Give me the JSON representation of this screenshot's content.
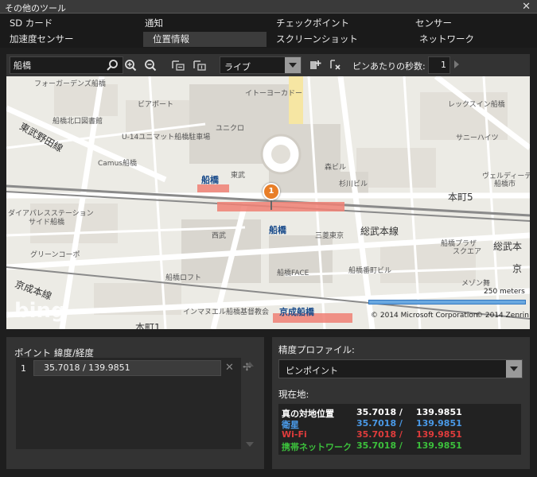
{
  "window": {
    "title": "その他のツール",
    "close_label": "✕"
  },
  "tabs": {
    "row1": [
      "SD カード",
      "通知",
      "チェックポイント",
      "センサー"
    ],
    "row2": [
      "加速度センサー",
      "位置情報",
      "スクリーンショット",
      "ネットワーク"
    ],
    "active": "位置情報"
  },
  "toolbar": {
    "search_value": "船橋",
    "mode_value": "ライブ",
    "seconds_label": "ピンあたりの秒数:",
    "seconds_value": "1"
  },
  "map": {
    "pin_label": "1",
    "labels": {
      "forager": "フォーガーデンズ船橋",
      "ito": "イトーヨーカドー",
      "rexin": "レックスイン船橋",
      "biaport": "ビアポート",
      "funabashi_kita": "船橋北口図書館",
      "u14": "U-14ユニマット船橋駐車場",
      "uniqlo": "ユニクロ",
      "sunny": "サニーハイツ",
      "higashi": "東武野田線",
      "camus": "Camus船橋",
      "mori": "森ビル",
      "sugino": "杉川ビル",
      "welldie": "ヴェルディーデ",
      "funabashi_nearby": "船橋市",
      "tobu": "東武",
      "honcho5": "本町5",
      "funabashi_station": "船橋",
      "diapalace": "ダイアパレスステーション",
      "side": "サイド船橋",
      "seibu": "西武",
      "sobu": "総武本線",
      "misu": "三菱東京",
      "green": "グリーンコーポ",
      "plaza": "船橋プラザ",
      "square": "スクエア",
      "sobu2": "総武本",
      "keisei_line": "京成本線",
      "loft": "船橋ロフト",
      "face": "船橋FACE",
      "funabashi_teramachi": "船橋番町ビル",
      "meison": "メゾン舞",
      "kyo": "京",
      "keisei_station": "京成船橋",
      "inmanel": "インマヌエル船橋基督教会",
      "honcho1": "本町1"
    },
    "scale_label": "250 meters",
    "bing": "bing",
    "copyright_ms": "© 2014 Microsoft Corporation",
    "copyright_zenrin": "© 2014 Zenrin"
  },
  "points_panel": {
    "col_point": "ポイント",
    "col_latlng": "緯度/経度",
    "rows": [
      {
        "index": "1",
        "coord": "35.7018 /  139.9851"
      }
    ]
  },
  "profile_panel": {
    "title": "精度プロファイル:",
    "value": "ピンポイント",
    "current_title": "現在地:",
    "locations": [
      {
        "name": "真の対地位置",
        "lat": "35.7018 /",
        "lng": "139.9851",
        "color": "#ffffff"
      },
      {
        "name": "衛星",
        "lat": "35.7018 /",
        "lng": "139.9851",
        "color": "#4a9ae8"
      },
      {
        "name": "Wi-Fi",
        "lat": "35.7018 /",
        "lng": "139.9851",
        "color": "#e03c3c"
      },
      {
        "name": "携帯ネットワーク",
        "lat": "35.7018 /",
        "lng": "139.9851",
        "color": "#3cc03c"
      }
    ]
  }
}
